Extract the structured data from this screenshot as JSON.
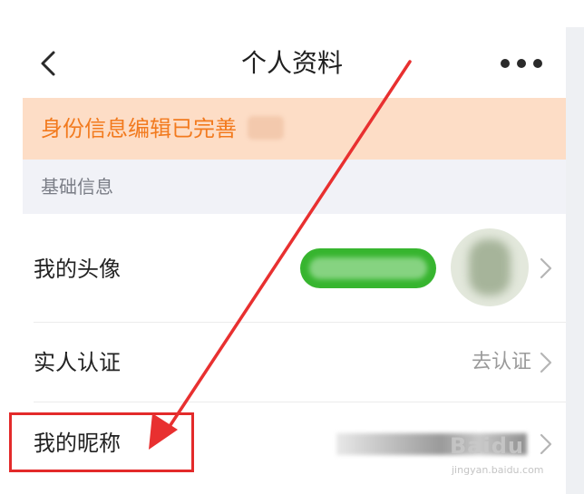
{
  "nav": {
    "title": "个人资料",
    "back_icon": "chevron-left-icon",
    "more_icon": "more-horizontal-icon"
  },
  "notice": {
    "text": "身份信息编辑已完善"
  },
  "section": {
    "label": "基础信息"
  },
  "rows": [
    {
      "label": "我的头像",
      "value": ""
    },
    {
      "label": "实人认证",
      "value": "去认证"
    },
    {
      "label": "我的昵称",
      "value": ""
    }
  ],
  "watermark": {
    "logo": "Bai​du",
    "url": "jingyan.baidu.com"
  },
  "colors": {
    "notice_bg": "#fdddc6",
    "notice_text": "#f27a1e",
    "section_bg": "#f1f2f7",
    "highlight": "#e32a2a",
    "pill_green": "#37b52f"
  }
}
